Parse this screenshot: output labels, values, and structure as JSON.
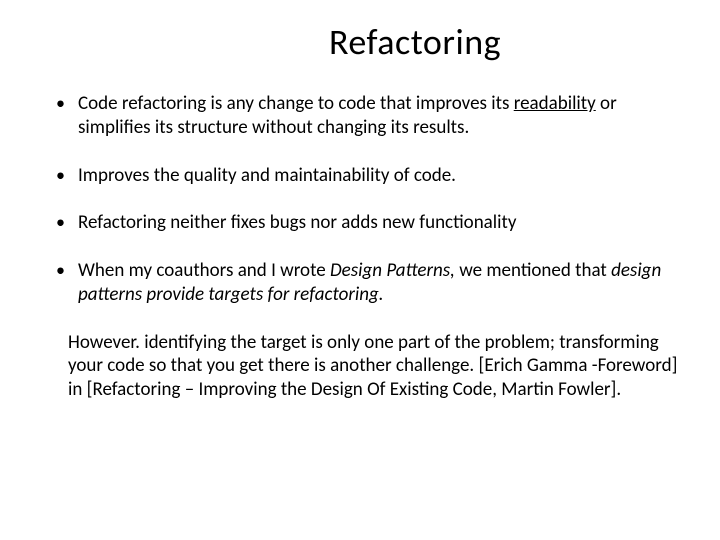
{
  "title": "Refactoring",
  "bullets": {
    "b1_pre": "Code refactoring is any change to code that improves its ",
    "b1_underline": "readability",
    "b1_post": " or simplifies its structure without changing its results.",
    "b2": "Improves the quality and maintainability of code.",
    "b3": "Refactoring neither fixes bugs nor adds new functionality",
    "b4_pre": "When my coauthors and I wrote ",
    "b4_italic1": "Design Patterns, ",
    "b4_mid": "we mentioned that ",
    "b4_italic2": "design patterns provide targets for refactoring."
  },
  "paragraph": "However. identifying the target is only one part of the problem; transforming your code so that you get there is another challenge. [Erich Gamma -Foreword] in [Refactoring – Improving the Design Of Existing Code, Martin Fowler]."
}
